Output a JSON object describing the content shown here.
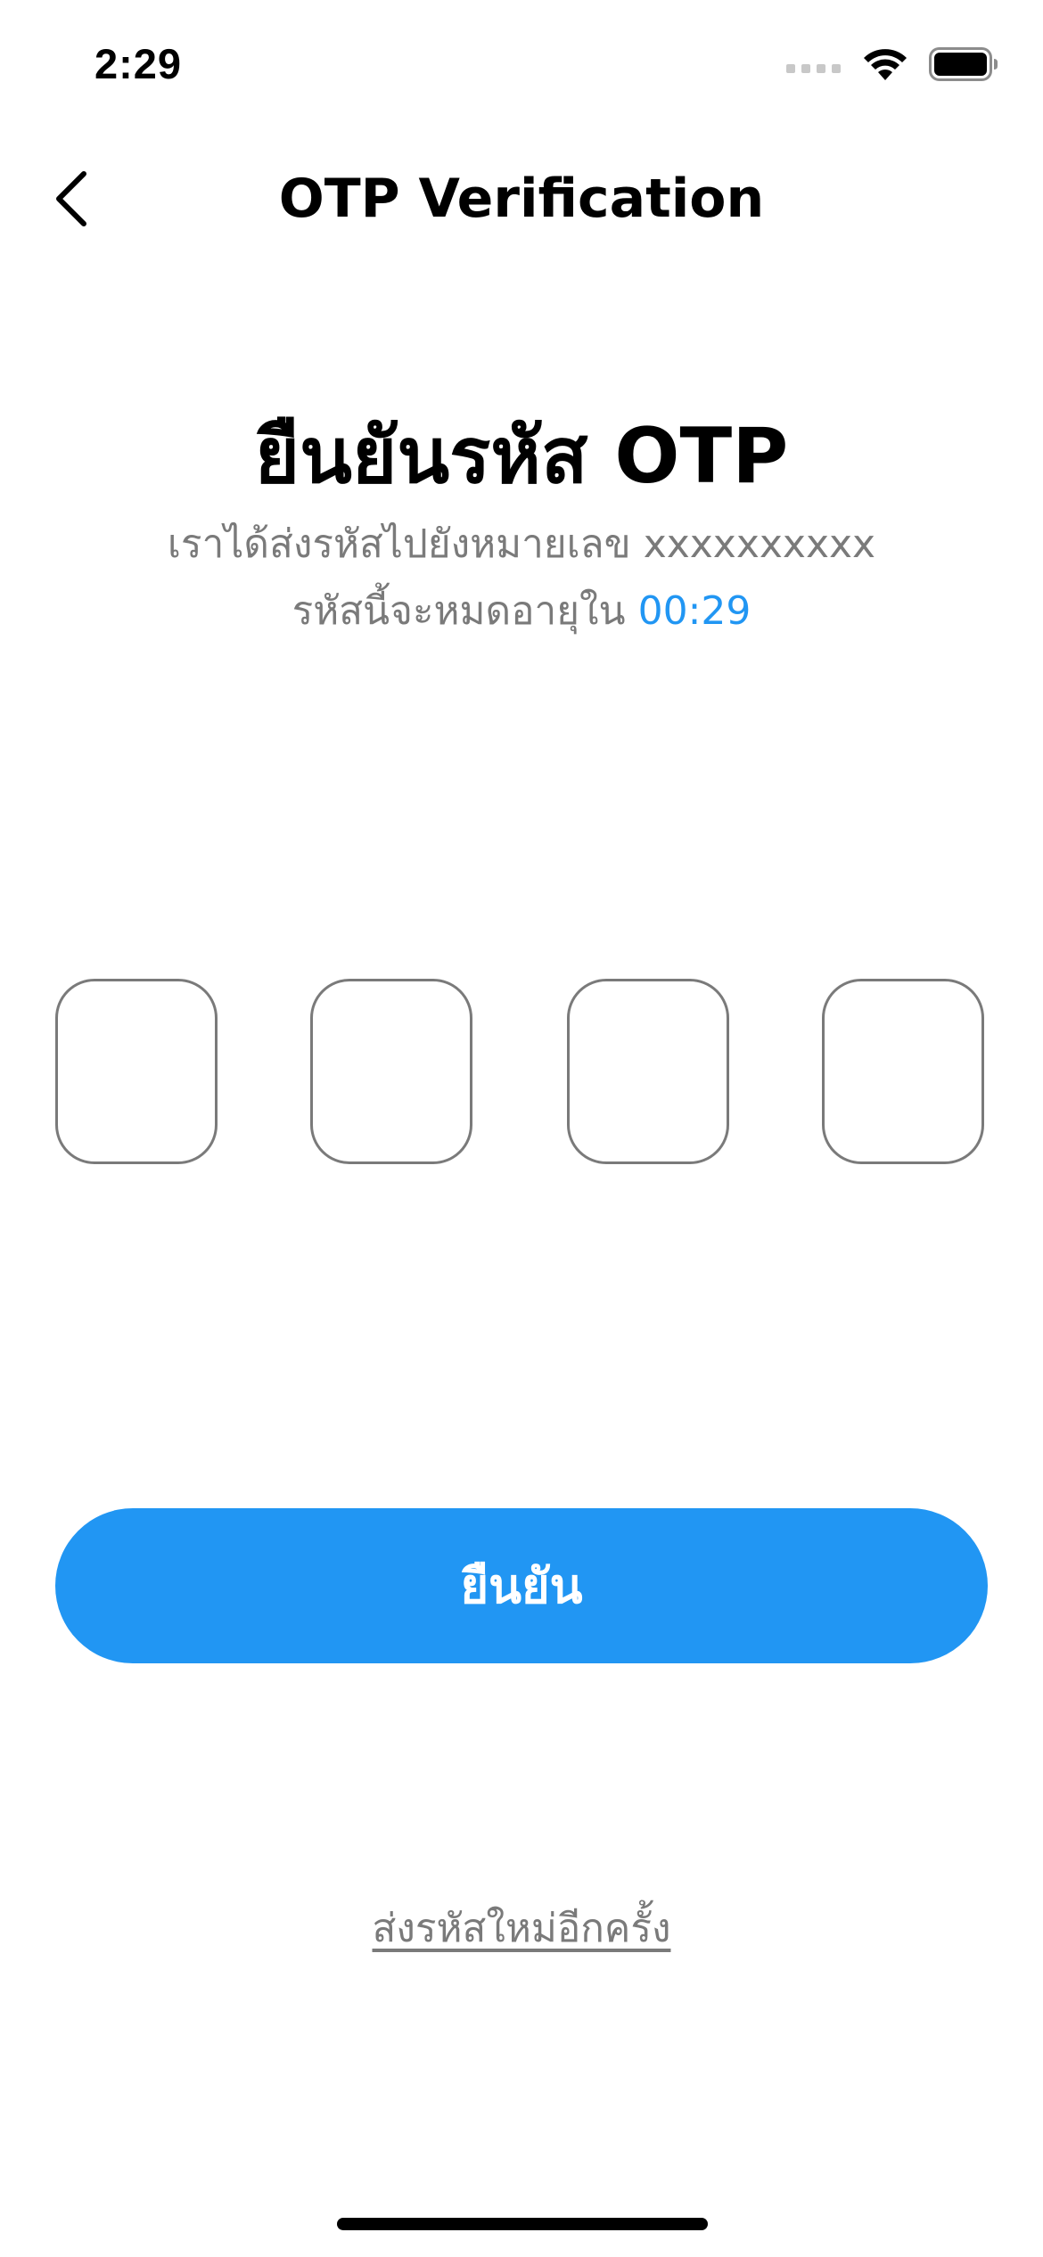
{
  "status_bar": {
    "time": "2:29"
  },
  "nav": {
    "title": "OTP Verification"
  },
  "heading": "ยืนยันรหัส OTP",
  "subtitle": {
    "line1": "เราได้ส่งรหัสไปยังหมายเลข xxxxxxxxxx",
    "line2_prefix": "รหัสนี้จะหมดอายุใน",
    "countdown": "00:29"
  },
  "otp": {
    "digits": [
      "",
      "",
      "",
      ""
    ]
  },
  "confirm_button": {
    "label": "ยืนยัน"
  },
  "resend_link": {
    "label": "ส่งรหัสใหม่อีกครั้ง"
  },
  "colors": {
    "accent": "#2196f3",
    "muted_text": "#7a7a7a",
    "border": "#7a7a7a"
  },
  "icons": {
    "back": "chevron-left-icon",
    "signal": "cellular-signal-icon",
    "wifi": "wifi-icon",
    "battery": "battery-icon"
  }
}
